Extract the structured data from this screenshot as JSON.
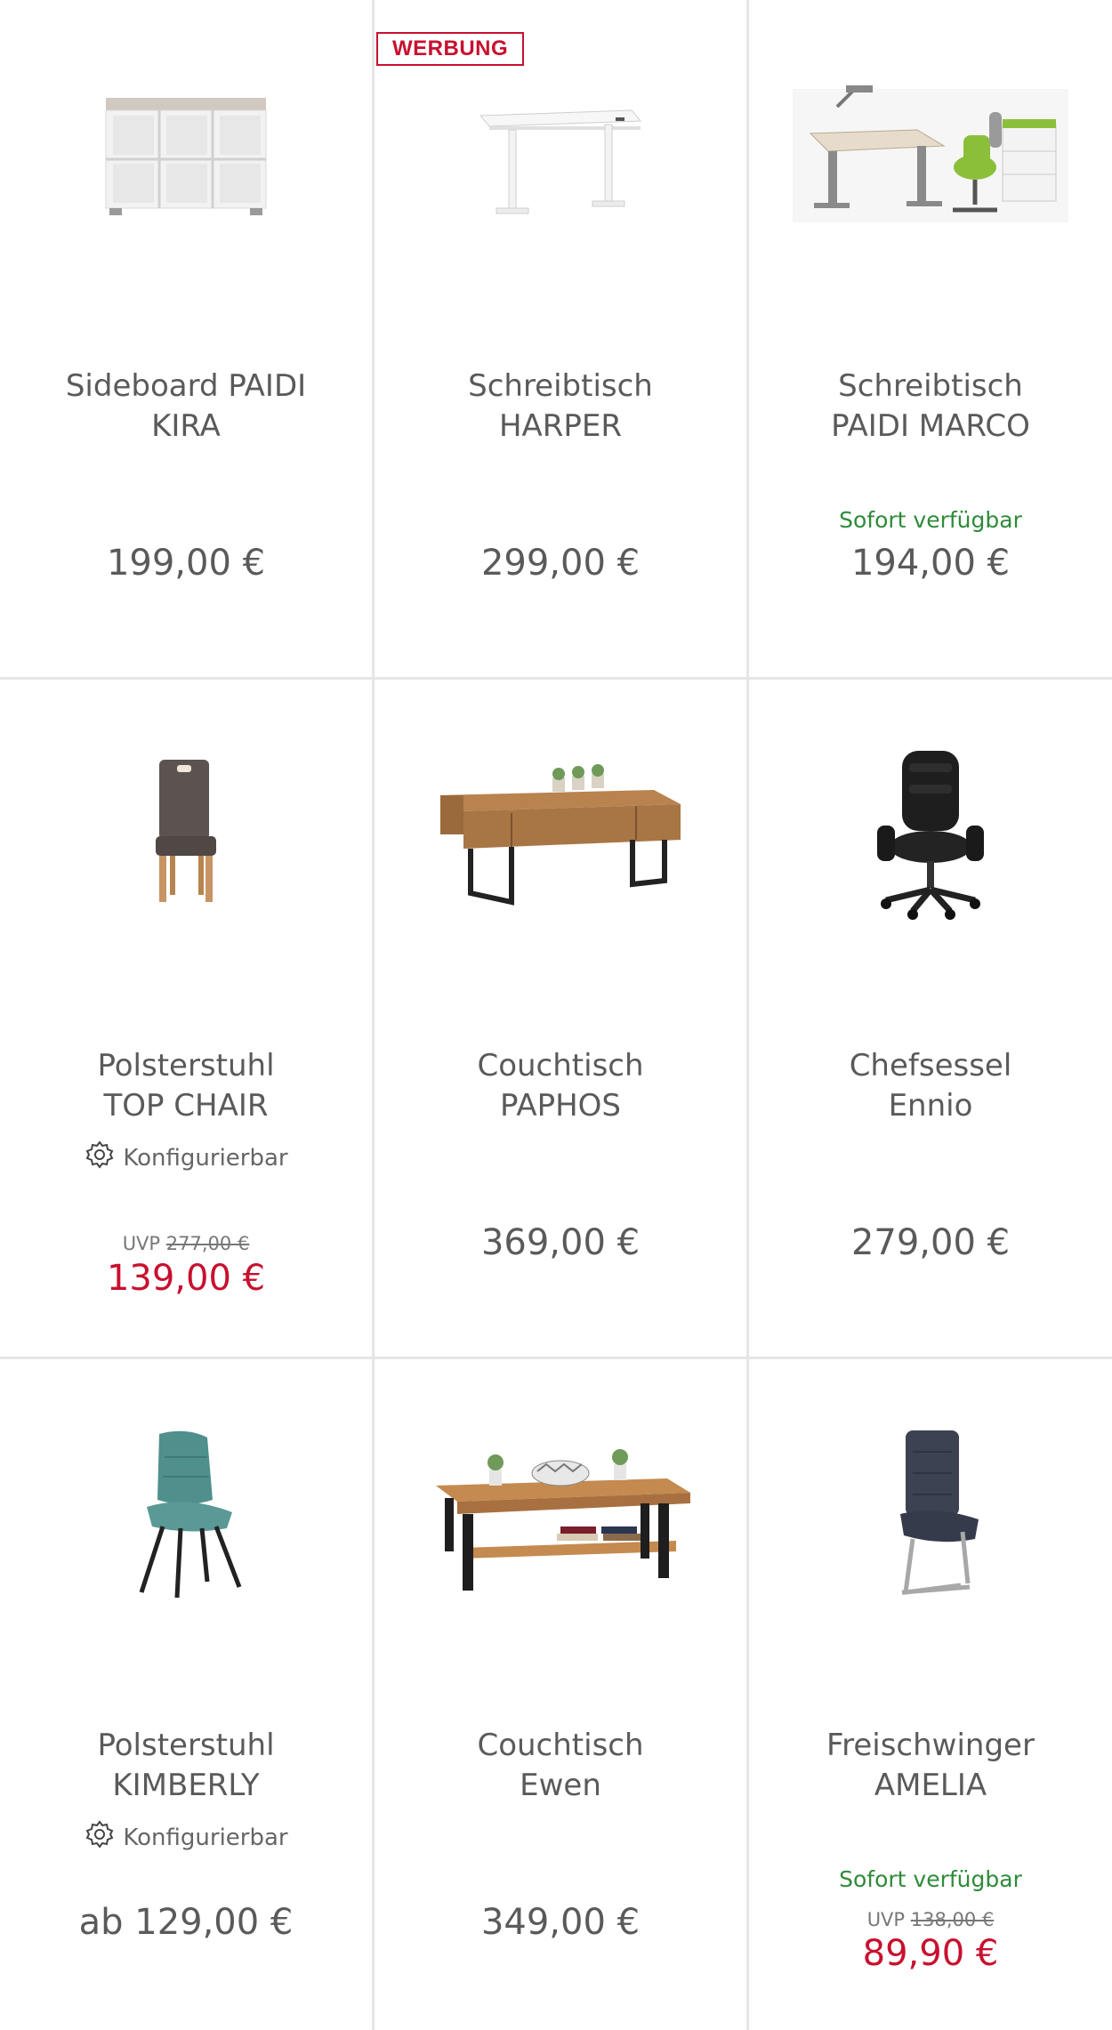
{
  "products": [
    {
      "title_line1": "Sideboard PAIDI",
      "title_line2": "KIRA",
      "price": "199,00 €",
      "image_icon": "sideboard-image"
    },
    {
      "badge": "WERBUNG",
      "title_line1": "Schreibtisch",
      "title_line2": "HARPER",
      "price": "299,00 €",
      "image_icon": "desk-image"
    },
    {
      "title_line1": "Schreibtisch",
      "title_line2": "PAIDI MARCO",
      "availability": "Sofort verfügbar",
      "price": "194,00 €",
      "image_icon": "kids-desk-set-image"
    },
    {
      "title_line1": "Polsterstuhl",
      "title_line2": "TOP CHAIR",
      "configurable": "Konfigurierbar",
      "uvp_label": "UVP",
      "uvp_price": "277,00 €",
      "price": "139,00 €",
      "image_icon": "upholstered-chair-image"
    },
    {
      "title_line1": "Couchtisch",
      "title_line2": "PAPHOS",
      "price": "369,00 €",
      "image_icon": "coffee-table-image"
    },
    {
      "title_line1": "Chefsessel",
      "title_line2": "Ennio",
      "price": "279,00 €",
      "image_icon": "office-chair-image"
    },
    {
      "title_line1": "Polsterstuhl",
      "title_line2": "KIMBERLY",
      "configurable": "Konfigurierbar",
      "price": "ab 129,00 €",
      "image_icon": "teal-chair-image"
    },
    {
      "title_line1": "Couchtisch",
      "title_line2": "Ewen",
      "price": "349,00 €",
      "image_icon": "coffee-table-shelf-image"
    },
    {
      "title_line1": "Freischwinger",
      "title_line2": "AMELIA",
      "availability": "Sofort verfügbar",
      "uvp_label": "UVP",
      "uvp_price": "138,00 €",
      "price": "89,90 €",
      "image_icon": "cantilever-chair-image"
    }
  ],
  "colors": {
    "sale_red": "#c8102e",
    "available_green": "#2e8b3a",
    "text_gray": "#5a5a5a",
    "divider": "#e6e6e6"
  },
  "icons": {
    "configurable": "gear-icon"
  }
}
